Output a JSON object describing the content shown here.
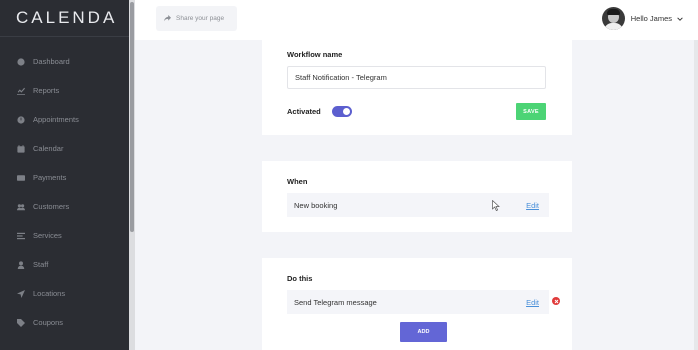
{
  "app": {
    "logo": "CALENDA"
  },
  "sidebar": {
    "items": [
      {
        "label": "Dashboard",
        "icon": "dashboard-icon"
      },
      {
        "label": "Reports",
        "icon": "reports-icon"
      },
      {
        "label": "Appointments",
        "icon": "appointments-icon"
      },
      {
        "label": "Calendar",
        "icon": "calendar-icon"
      },
      {
        "label": "Payments",
        "icon": "payments-icon"
      },
      {
        "label": "Customers",
        "icon": "customers-icon"
      },
      {
        "label": "Services",
        "icon": "services-icon"
      },
      {
        "label": "Staff",
        "icon": "staff-icon"
      },
      {
        "label": "Locations",
        "icon": "locations-icon"
      },
      {
        "label": "Coupons",
        "icon": "coupons-icon"
      }
    ]
  },
  "header": {
    "share_label": "Share your page",
    "user_greeting": "Hello James"
  },
  "workflow": {
    "name_label": "Workflow name",
    "name_value": "Staff Notification - Telegram",
    "activated_label": "Activated",
    "activated": true,
    "save_label": "SAVE"
  },
  "when": {
    "title": "When",
    "trigger": "New booking",
    "edit_label": "Edit"
  },
  "do_this": {
    "title": "Do this",
    "action": "Send Telegram message",
    "edit_label": "Edit",
    "add_label": "ADD"
  },
  "colors": {
    "sidebar_bg": "#2b2d33",
    "accent": "#6366d6",
    "save_green": "#4cd475",
    "remove_red": "#e03b3b",
    "link_blue": "#4a90d9"
  }
}
